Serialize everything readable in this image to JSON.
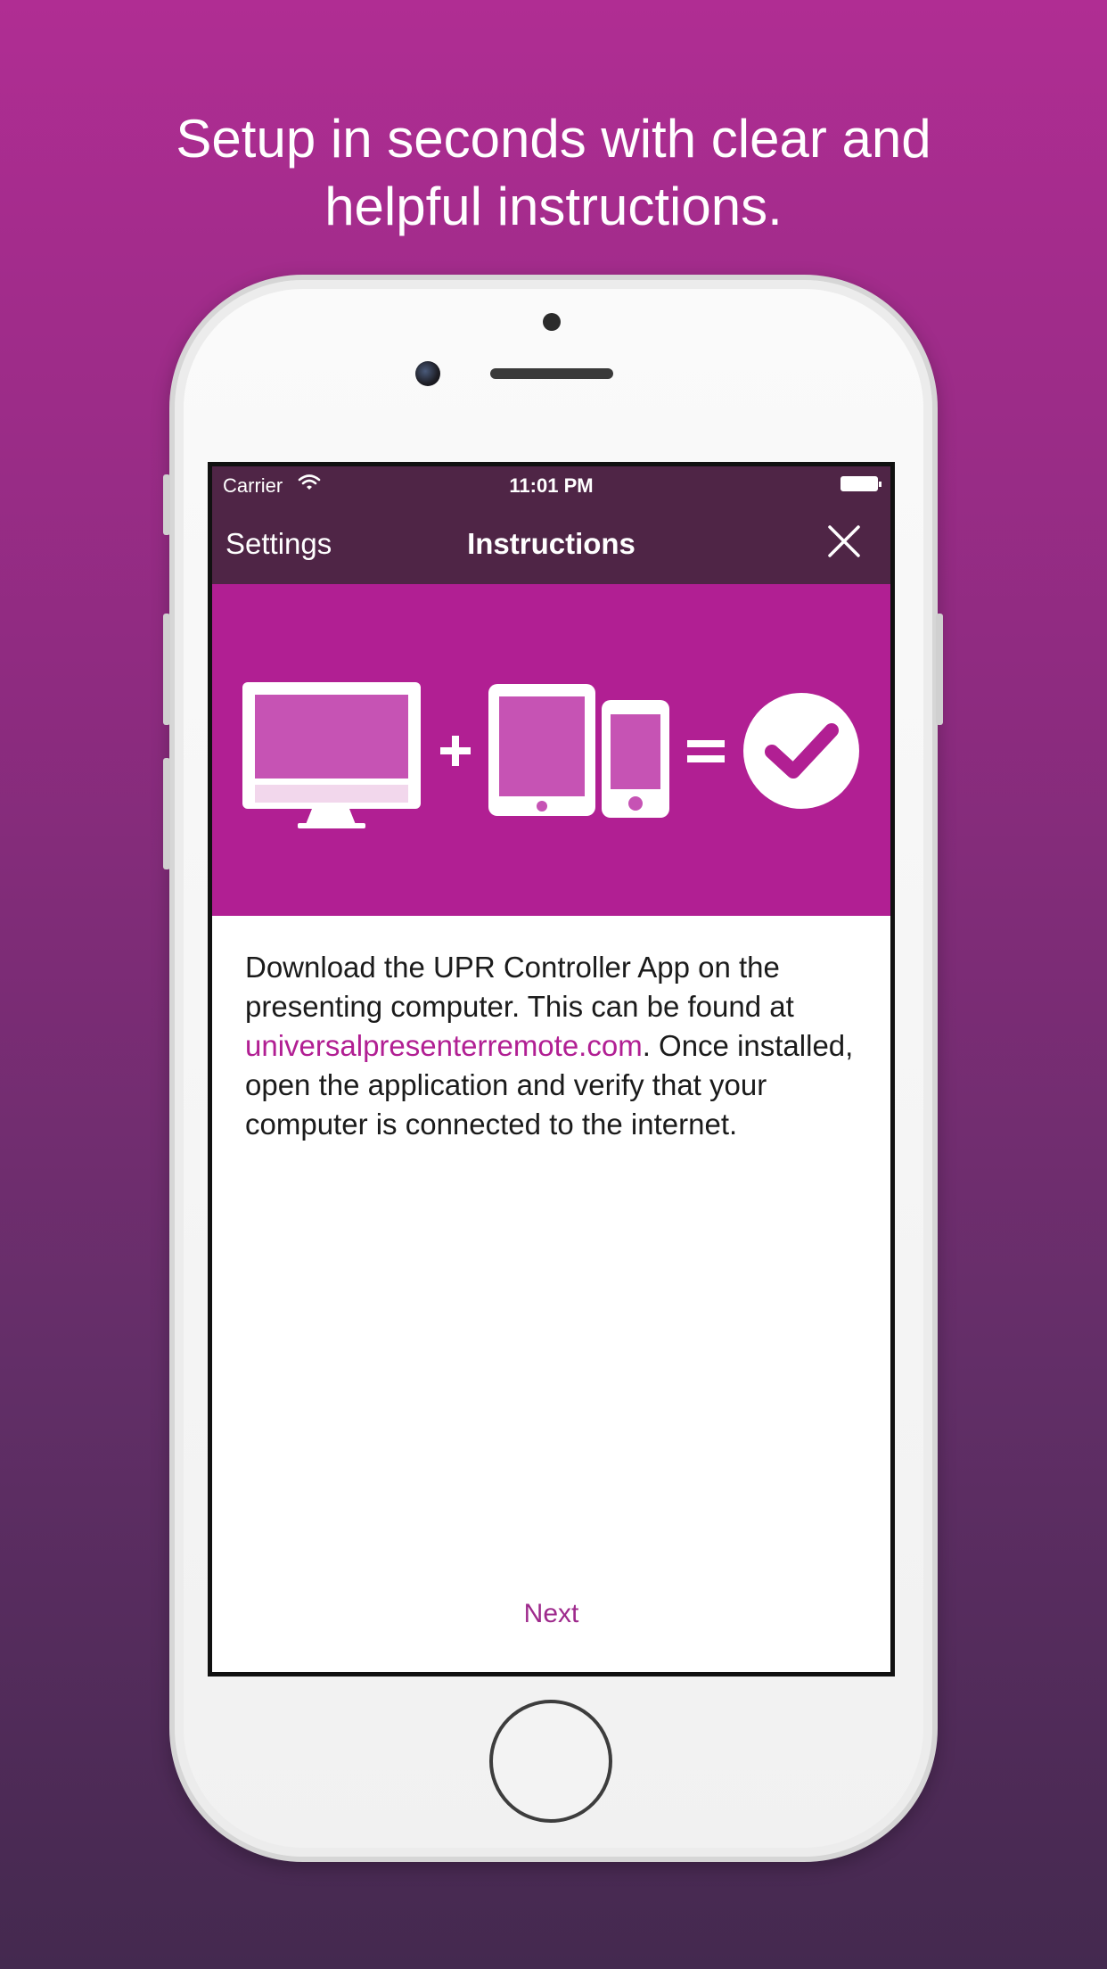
{
  "headline": {
    "line1": "Setup in seconds with clear and",
    "line2": "helpful instructions."
  },
  "status_bar": {
    "carrier": "Carrier",
    "time": "11:01 PM",
    "wifi_icon": "wifi-icon",
    "battery_icon": "battery-icon"
  },
  "nav": {
    "left_label": "Settings",
    "title": "Instructions",
    "close_icon": "close-icon"
  },
  "hero": {
    "background": "#b11f93",
    "icons": [
      "desktop-computer-icon",
      "plus-icon",
      "tablet-icon",
      "phone-icon",
      "equals-icon",
      "checkmark-circle-icon"
    ]
  },
  "instructions": {
    "text_before": "Download the UPR Controller App on the presenting computer. This can be found at ",
    "link": "universalpresenterremote.com",
    "text_after": ". Once installed, open the application and verify that your computer is connected to the internet."
  },
  "footer": {
    "next_label": "Next"
  },
  "colors": {
    "accent": "#b11f93",
    "nav_background": "#4f2546",
    "link": "#b11f93"
  }
}
